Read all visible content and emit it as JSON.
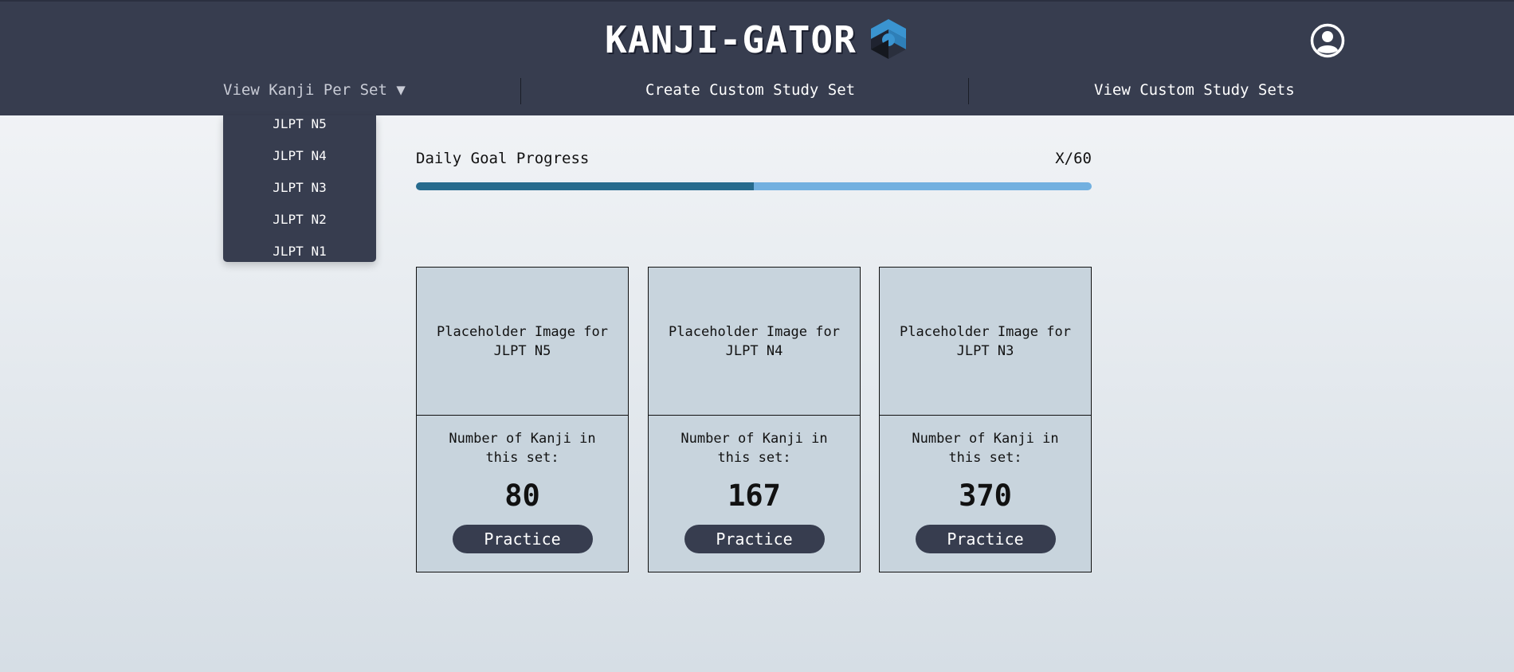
{
  "header": {
    "title": "KANJI-GATOR",
    "logo_icon": "hexagon-logo-icon",
    "profile_icon": "user-profile-icon",
    "background": "#373d4f"
  },
  "nav": {
    "view_per_set": "View Kanji Per Set ▼",
    "create_custom": "Create Custom Study Set",
    "view_custom": "View Custom Study Sets"
  },
  "dropdown": {
    "items": [
      {
        "label": "JLPT N5"
      },
      {
        "label": "JLPT N4"
      },
      {
        "label": "JLPT N3"
      },
      {
        "label": "JLPT N2"
      },
      {
        "label": "JLPT N1"
      }
    ]
  },
  "goal": {
    "label": "Daily Goal Progress",
    "count": "X/60",
    "progress": 0.5
  },
  "cards": [
    {
      "image_text": "Placeholder Image for JLPT N5",
      "count_label": "Number of Kanji in this set:",
      "count": "80",
      "button": "Practice"
    },
    {
      "image_text": "Placeholder Image for JLPT N4",
      "count_label": "Number of Kanji in this set:",
      "count": "167",
      "button": "Practice"
    },
    {
      "image_text": "Placeholder Image for JLPT N3",
      "count_label": "Number of Kanji in this set:",
      "count": "370",
      "button": "Practice"
    }
  ],
  "colors": {
    "accent_dark": "#373d4f",
    "progress_fill": "#276b8d",
    "progress_track": "#72b0e0",
    "card_bg": "#c8d4dd"
  }
}
